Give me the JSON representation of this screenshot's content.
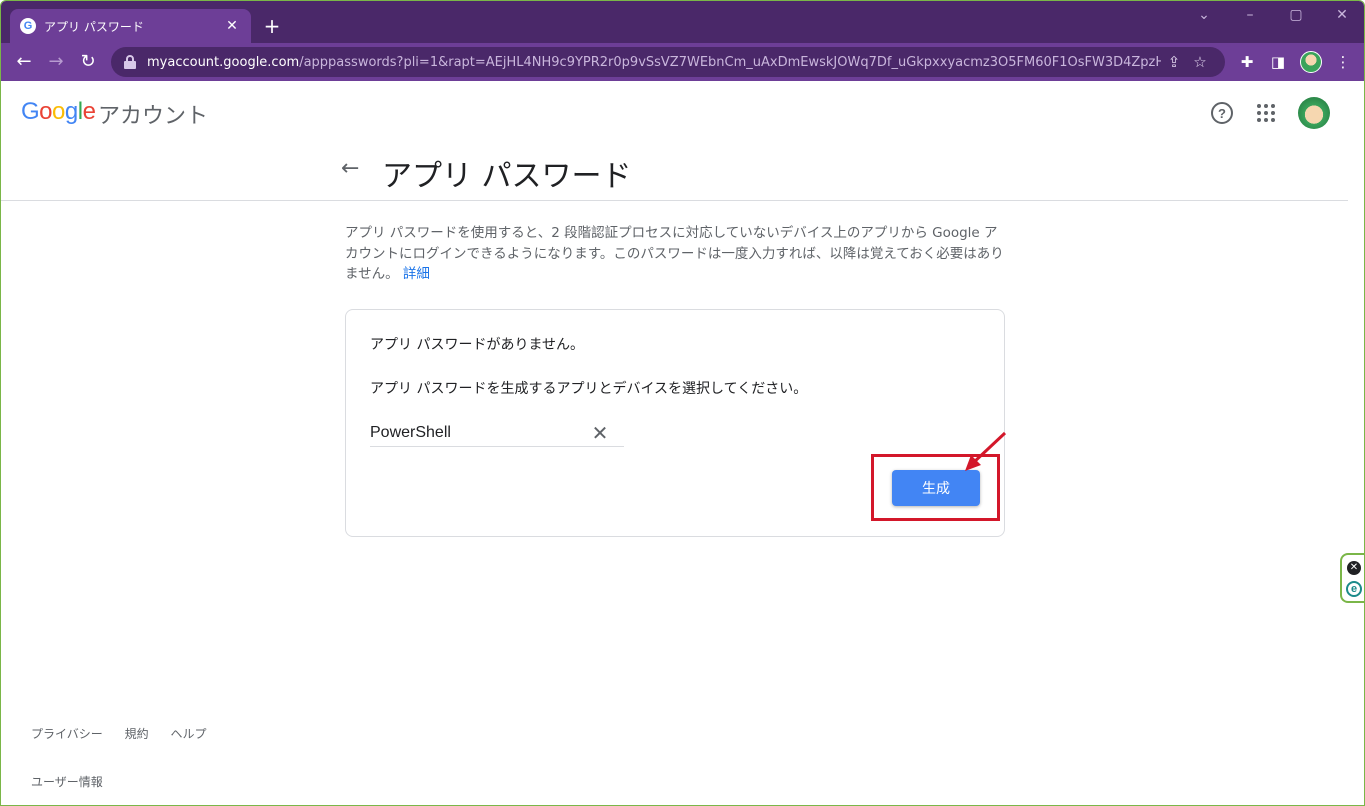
{
  "browser": {
    "tab_title": "アプリ パスワード",
    "tab_favicon": "G",
    "tab_close": "✕",
    "new_tab": "+",
    "url_host": "myaccount.google.com",
    "url_path": "/apppasswords?pli=1&rapt=AEjHL4NH9c9YPR2r0p9vSsVZ7WEbnCm_uAxDmEwskJOWq7Df_uGkpxxyacmz3O5FM60F1OsFW3D4ZpzHzAt2...",
    "icons": [
      "back-icon",
      "forward-icon",
      "reload-icon",
      "lock-icon",
      "share-icon",
      "star-icon",
      "extensions-icon",
      "side-panel-icon",
      "profile-avatar",
      "menu-icon"
    ]
  },
  "header": {
    "logo": {
      "g1": "G",
      "g2": "o",
      "g3": "o",
      "g4": "g",
      "g5": "l",
      "g6": "e"
    },
    "product": "アカウント",
    "help_icon": "?"
  },
  "page": {
    "title": "アプリ パスワード",
    "back_icon": "←"
  },
  "description": {
    "text": "アプリ パスワードを使用すると、2 段階認証プロセスに対応していないデバイス上のアプリから Google アカウントにログインできるようになります。このパスワードは一度入力すれば、以降は覚えておく必要はありません。",
    "link": "詳細"
  },
  "card": {
    "no_passwords": "アプリ パスワードがありません。",
    "instruction": "アプリ パスワードを生成するアプリとデバイスを選択してください。",
    "app_field_value": "PowerShell",
    "clear_icon": "✕",
    "generate_label": "生成"
  },
  "footer": {
    "privacy": "プライバシー",
    "terms": "規約",
    "help": "ヘルプ",
    "user_info": "ユーザー情報"
  },
  "colors": {
    "tabbar": "#4a2869",
    "toolbar": "#6d3e97",
    "primary_button": "#4285f4",
    "annotation": "#d3172a",
    "link": "#1a73e8"
  }
}
